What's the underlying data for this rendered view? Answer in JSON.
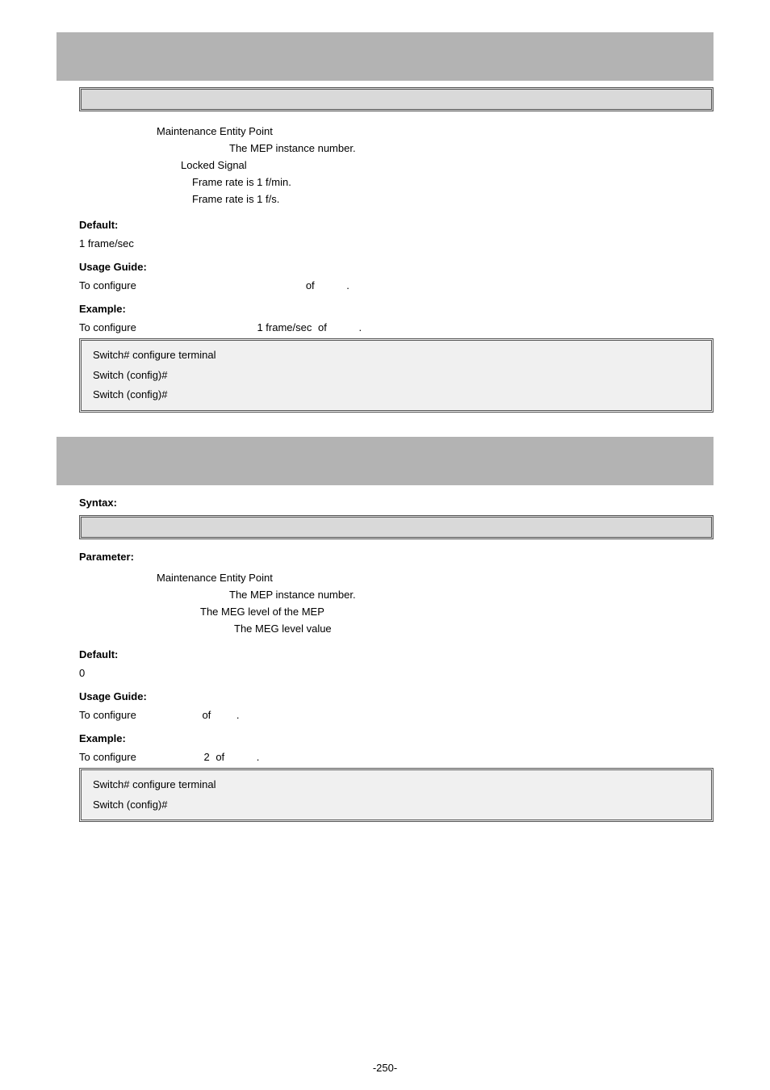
{
  "sec1": {
    "def_mep_label": "Maintenance Entity Point",
    "def_instance_label": "The MEP instance number.",
    "def_lck_label": "Locked Signal",
    "def_1m_label": "Frame rate is 1 f/min.",
    "def_1s_label": "Frame rate is 1 f/s.",
    "default_heading": "Default:",
    "default_value": "1 frame/sec",
    "usage_heading": "Usage Guide:",
    "usage_text_pre": "To configure",
    "usage_text_mid": "of",
    "usage_text_end": ".",
    "example_heading": "Example:",
    "example_pre": "To configure",
    "example_mid": "1 frame/sec",
    "example_of": "of",
    "example_end": ".",
    "example_line1": "Switch# configure terminal",
    "example_line2": "Switch (config)#",
    "example_line3": "Switch (config)#"
  },
  "sec2": {
    "syntax_heading": "Syntax:",
    "parameter_heading": "Parameter:",
    "def_mep_label": "Maintenance Entity Point",
    "def_instance_label": "The MEP instance number.",
    "def_level_label": "The MEG level of the MEP",
    "def_07_label": "The MEG level value",
    "default_heading": "Default:",
    "default_value": "0",
    "usage_heading": "Usage Guide:",
    "usage_text_pre": "To configure",
    "usage_text_mid": "of",
    "usage_text_end": ".",
    "example_heading": "Example:",
    "example_pre": "To configure",
    "example_val": "2",
    "example_of": "of",
    "example_end": ".",
    "example_line1": "Switch# configure terminal",
    "example_line2": "Switch (config)#"
  },
  "page_number": "-250-"
}
